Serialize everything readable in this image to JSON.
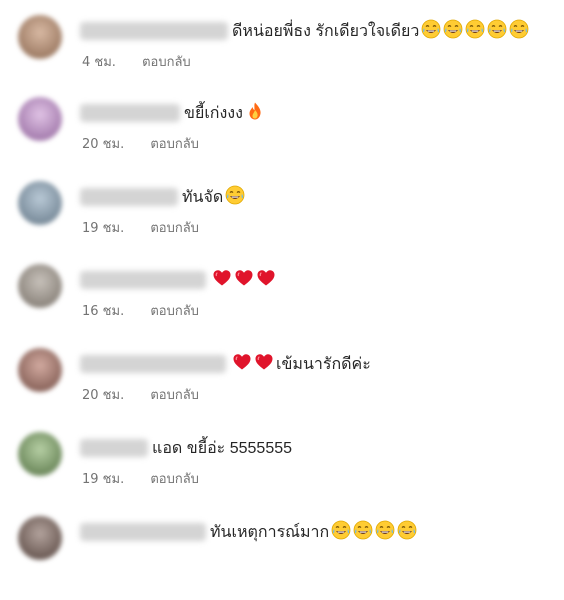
{
  "colors": {
    "text": "#262626",
    "meta": "#737373",
    "background": "#ffffff"
  },
  "comments": [
    {
      "text": "ดีหน่อยพี่ธง รักเดียวใจเดียว",
      "emoji": [
        "laugh-cry-emoji",
        "laugh-cry-emoji",
        "laugh-cry-emoji",
        "laugh-cry-emoji",
        "laugh-cry-emoji"
      ],
      "time": "4 ชม.",
      "reply": "ตอบกลับ",
      "avatar_color": "#b89a86"
    },
    {
      "text": "ขยี้เก่งงง",
      "emoji": [
        "fire-emoji"
      ],
      "time": "20 ชม.",
      "reply": "ตอบกลับ",
      "avatar_color": "#c9a8cf"
    },
    {
      "text": "ทันจัด",
      "emoji": [
        "laugh-cry-emoji"
      ],
      "time": "19 ชม.",
      "reply": "ตอบกลับ",
      "avatar_color": "#8fa3b3"
    },
    {
      "text": "",
      "emoji": [
        "red-heart-emoji",
        "red-heart-emoji",
        "red-heart-emoji"
      ],
      "time": "16 ชม.",
      "reply": "ตอบกลับ",
      "avatar_color": "#a9a39c"
    },
    {
      "text": "เข้มนารักดีค่ะ",
      "emoji": [
        "red-heart-emoji",
        "red-heart-emoji"
      ],
      "emoji_before_text": true,
      "time": "20 ชม.",
      "reply": "ตอบกลับ",
      "avatar_color": "#b08a80"
    },
    {
      "text": "แอด ขยี้อ่ะ 5555555",
      "emoji": [],
      "time": "19 ชม.",
      "reply": "ตอบกลับ",
      "avatar_color": "#8ca67c"
    },
    {
      "text": "ทันเหตุการณ์มาก",
      "emoji": [
        "laugh-cry-emoji",
        "laugh-cry-emoji",
        "laugh-cry-emoji",
        "laugh-cry-emoji"
      ],
      "time": "",
      "reply": "",
      "avatar_color": "#8a7a74"
    }
  ]
}
